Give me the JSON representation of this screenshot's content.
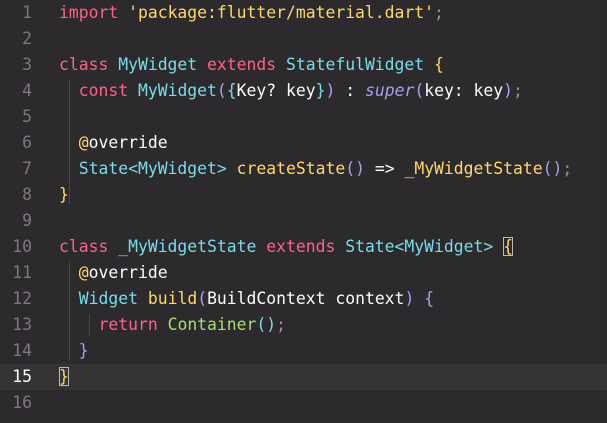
{
  "editor": {
    "language": "dart",
    "active_line": 15,
    "line_numbers": [
      "1",
      "2",
      "3",
      "4",
      "5",
      "6",
      "7",
      "8",
      "9",
      "10",
      "11",
      "12",
      "13",
      "14",
      "15",
      "16"
    ],
    "lines": [
      [
        {
          "t": "import",
          "c": "kw"
        },
        {
          "t": " ",
          "c": "plain"
        },
        {
          "t": "'package:flutter/material.dart'",
          "c": "str"
        },
        {
          "t": ";",
          "c": "punc"
        }
      ],
      [],
      [
        {
          "t": "class",
          "c": "kw"
        },
        {
          "t": " ",
          "c": "plain"
        },
        {
          "t": "MyWidget",
          "c": "cls"
        },
        {
          "t": " ",
          "c": "plain"
        },
        {
          "t": "extends",
          "c": "kw"
        },
        {
          "t": " ",
          "c": "plain"
        },
        {
          "t": "StatefulWidget",
          "c": "cls"
        },
        {
          "t": " ",
          "c": "plain"
        },
        {
          "t": "{",
          "c": "br1"
        }
      ],
      [
        {
          "t": "  ",
          "c": "plain"
        },
        {
          "t": "const",
          "c": "kw"
        },
        {
          "t": " ",
          "c": "plain"
        },
        {
          "t": "MyWidget",
          "c": "cls"
        },
        {
          "t": "(",
          "c": "br2"
        },
        {
          "t": "{",
          "c": "br3"
        },
        {
          "t": "Key? key",
          "c": "plain"
        },
        {
          "t": "}",
          "c": "br3"
        },
        {
          "t": ")",
          "c": "br2"
        },
        {
          "t": " : ",
          "c": "plain"
        },
        {
          "t": "super",
          "c": "super"
        },
        {
          "t": "(",
          "c": "br2"
        },
        {
          "t": "key: key",
          "c": "plain"
        },
        {
          "t": ")",
          "c": "br2"
        },
        {
          "t": ";",
          "c": "punc"
        }
      ],
      [],
      [
        {
          "t": "  ",
          "c": "plain"
        },
        {
          "t": "@",
          "c": "ann"
        },
        {
          "t": "override",
          "c": "plain"
        }
      ],
      [
        {
          "t": "  ",
          "c": "plain"
        },
        {
          "t": "State<MyWidget>",
          "c": "cls"
        },
        {
          "t": " ",
          "c": "plain"
        },
        {
          "t": "createState",
          "c": "fnb"
        },
        {
          "t": "()",
          "c": "br2"
        },
        {
          "t": " => ",
          "c": "plain"
        },
        {
          "t": "_MyWidgetState",
          "c": "fnb"
        },
        {
          "t": "()",
          "c": "br2"
        },
        {
          "t": ";",
          "c": "punc"
        }
      ],
      [
        {
          "t": "}",
          "c": "br1"
        }
      ],
      [],
      [
        {
          "t": "class",
          "c": "kw"
        },
        {
          "t": " ",
          "c": "plain"
        },
        {
          "t": "_MyWidgetState",
          "c": "cls"
        },
        {
          "t": " ",
          "c": "plain"
        },
        {
          "t": "extends",
          "c": "kw"
        },
        {
          "t": " ",
          "c": "plain"
        },
        {
          "t": "State<MyWidget>",
          "c": "cls"
        },
        {
          "t": " ",
          "c": "plain"
        },
        {
          "t": "{",
          "c": "br1",
          "match": true
        }
      ],
      [
        {
          "t": "  ",
          "c": "plain"
        },
        {
          "t": "@",
          "c": "ann"
        },
        {
          "t": "override",
          "c": "plain"
        }
      ],
      [
        {
          "t": "  ",
          "c": "plain"
        },
        {
          "t": "Widget",
          "c": "cls"
        },
        {
          "t": " ",
          "c": "plain"
        },
        {
          "t": "build",
          "c": "fnb"
        },
        {
          "t": "(",
          "c": "br2"
        },
        {
          "t": "BuildContext context",
          "c": "plain"
        },
        {
          "t": ")",
          "c": "br2"
        },
        {
          "t": " ",
          "c": "plain"
        },
        {
          "t": "{",
          "c": "br2"
        }
      ],
      [
        {
          "t": "    ",
          "c": "plain"
        },
        {
          "t": "return",
          "c": "kw"
        },
        {
          "t": " ",
          "c": "plain"
        },
        {
          "t": "Container",
          "c": "fn"
        },
        {
          "t": "()",
          "c": "br3"
        },
        {
          "t": ";",
          "c": "punc"
        }
      ],
      [
        {
          "t": "  ",
          "c": "plain"
        },
        {
          "t": "}",
          "c": "br2"
        }
      ],
      [
        {
          "t": "}",
          "c": "br1",
          "match": true
        }
      ],
      []
    ]
  }
}
